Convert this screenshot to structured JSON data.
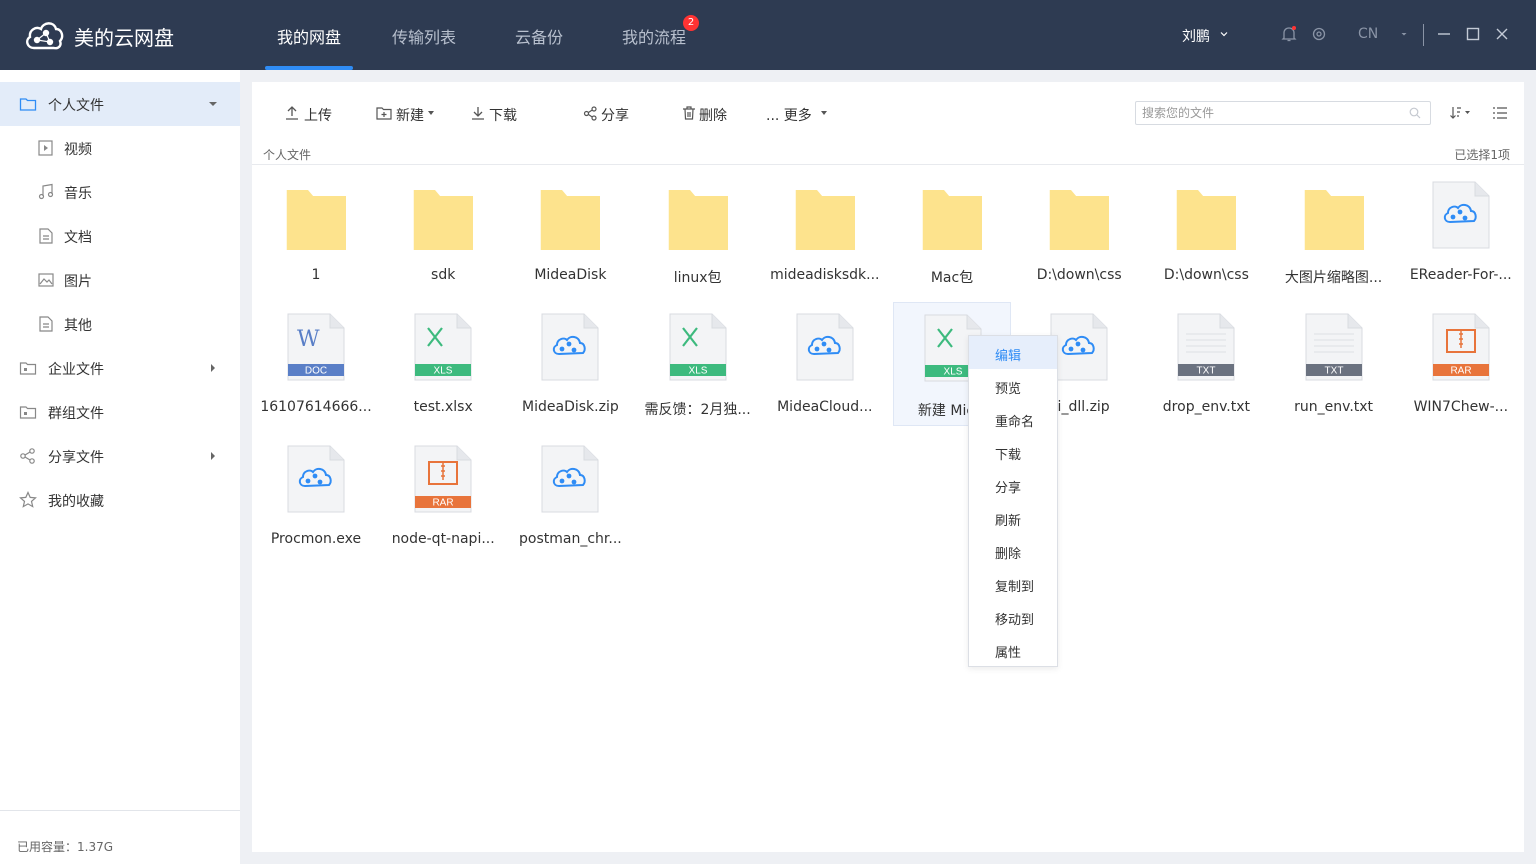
{
  "app": {
    "title": "美的云网盘"
  },
  "nav": {
    "tabs": [
      {
        "label": "我的网盘"
      },
      {
        "label": "传输列表"
      },
      {
        "label": "云备份"
      },
      {
        "label": "我的流程"
      }
    ],
    "active_index": 0,
    "flow_badge": "2"
  },
  "header": {
    "user": "刘鹏",
    "lang": "CN"
  },
  "sidebar": {
    "items": [
      {
        "label": "个人文件",
        "icon": "folder-icon",
        "expanded": true
      },
      {
        "label": "视频",
        "icon": "video-icon"
      },
      {
        "label": "音乐",
        "icon": "music-icon"
      },
      {
        "label": "文档",
        "icon": "document-icon"
      },
      {
        "label": "图片",
        "icon": "image-icon"
      },
      {
        "label": "其他",
        "icon": "other-file-icon"
      },
      {
        "label": "企业文件",
        "icon": "enterprise-folder-icon"
      },
      {
        "label": "群组文件",
        "icon": "group-folder-icon"
      },
      {
        "label": "分享文件",
        "icon": "share-icon"
      },
      {
        "label": "我的收藏",
        "icon": "star-icon"
      }
    ],
    "storage": "已用容量：1.37G"
  },
  "toolbar": {
    "upload": "上传",
    "new": "新建",
    "download": "下载",
    "share": "分享",
    "delete": "删除",
    "more": "... 更多",
    "search_placeholder": "搜索您的文件"
  },
  "breadcrumb": "个人文件",
  "selected_count": "已选择1项",
  "files": [
    {
      "name": "1",
      "type": "folder"
    },
    {
      "name": "sdk",
      "type": "folder"
    },
    {
      "name": "MideaDisk",
      "type": "folder"
    },
    {
      "name": "linux包",
      "type": "folder"
    },
    {
      "name": "mideadisksdk...",
      "type": "folder"
    },
    {
      "name": "Mac包",
      "type": "folder"
    },
    {
      "name": "D:\\down\\css",
      "type": "folder"
    },
    {
      "name": "D:\\down\\css",
      "type": "folder"
    },
    {
      "name": "大图片缩略图...",
      "type": "folder"
    },
    {
      "name": "EReader-For-...",
      "type": "cloud"
    },
    {
      "name": "16107614666...",
      "type": "doc",
      "badge": "DOC"
    },
    {
      "name": "test.xlsx",
      "type": "xls",
      "badge": "XLS"
    },
    {
      "name": "MideaDisk.zip",
      "type": "cloud"
    },
    {
      "name": "需反馈：2月独...",
      "type": "xls",
      "badge": "XLS"
    },
    {
      "name": "MideaCloud...",
      "type": "cloud"
    },
    {
      "name": "新建 Micro",
      "type": "xls",
      "badge": "XLS",
      "selected": true
    },
    {
      "name": "pi_dll.zip",
      "type": "cloud"
    },
    {
      "name": "drop_env.txt",
      "type": "txt",
      "badge": "TXT"
    },
    {
      "name": "run_env.txt",
      "type": "txt",
      "badge": "TXT"
    },
    {
      "name": "WIN7Chew-...",
      "type": "rar",
      "badge": "RAR"
    },
    {
      "name": "Procmon.exe",
      "type": "cloud"
    },
    {
      "name": "node-qt-napi...",
      "type": "rar",
      "badge": "RAR"
    },
    {
      "name": "postman_chr...",
      "type": "cloud"
    }
  ],
  "context_menu": {
    "items": [
      "编辑",
      "预览",
      "重命名",
      "下载",
      "分享",
      "刷新",
      "删除",
      "复制到",
      "移动到",
      "属性"
    ],
    "active_index": 0
  },
  "colors": {
    "topbar": "#2e3b52",
    "accent": "#2f8cf5",
    "folder": "#fde38d",
    "doc": "#5a7fc7",
    "xls": "#3dba7e",
    "txt": "#6b7280",
    "rar": "#e8743b"
  }
}
